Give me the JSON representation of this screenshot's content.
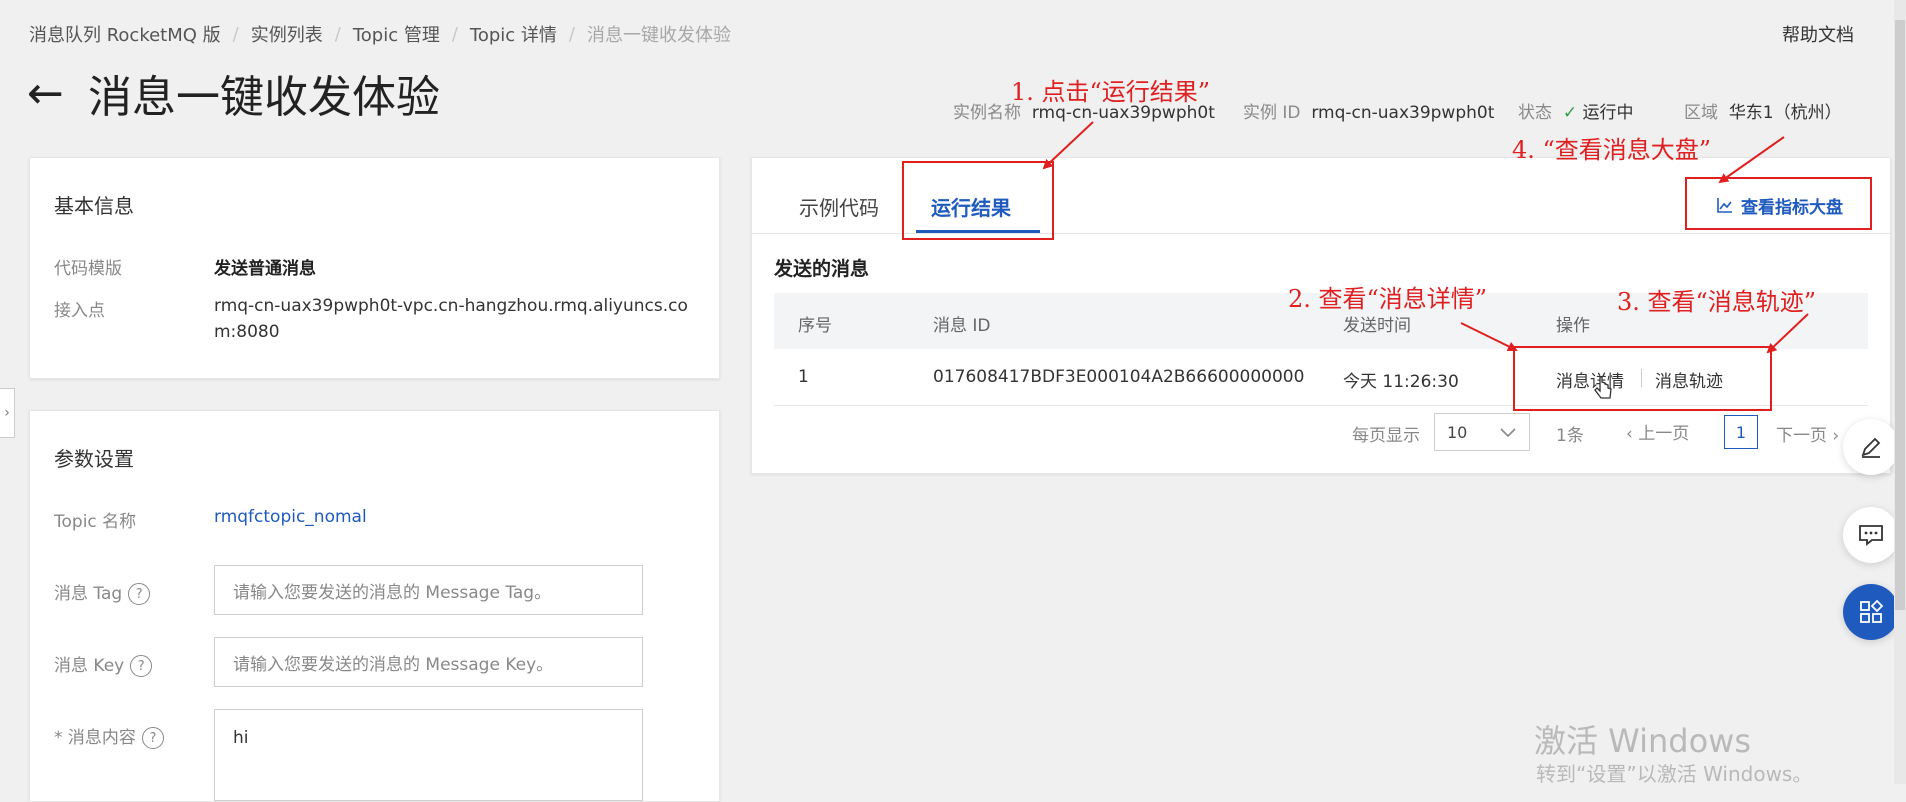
{
  "breadcrumb": [
    "消息队列 RocketMQ 版",
    "实例列表",
    "Topic 管理",
    "Topic 详情",
    "消息一键收发体验"
  ],
  "help_link": "帮助文档",
  "page_title": "消息一键收发体验",
  "instance": {
    "name_label": "实例名称",
    "name_value": "rmq-cn-uax39pwph0t",
    "id_label": "实例 ID",
    "id_value": "rmq-cn-uax39pwph0t",
    "status_label": "状态",
    "status_value": "运行中",
    "region_label": "区域",
    "region_value": "华东1（杭州）"
  },
  "basic_info": {
    "title": "基本信息",
    "template_label": "代码模版",
    "template_value": "发送普通消息",
    "endpoint_label": "接入点",
    "endpoint_line1": "rmq-cn-uax39pwph0t-vpc.cn-hangzhou.rmq.aliyuncs.co",
    "endpoint_line2": "m:8080"
  },
  "params": {
    "title": "参数设置",
    "topic_label": "Topic 名称",
    "topic_value": "rmqfctopic_nomal",
    "tag_label": "消息 Tag",
    "tag_placeholder": "请输入您要发送的消息的 Message Tag。",
    "key_label": "消息 Key",
    "key_placeholder": "请输入您要发送的消息的 Message Key。",
    "content_label": "* 消息内容",
    "content_value": "hi",
    "help_glyph": "?"
  },
  "tabs": {
    "sample_code": "示例代码",
    "run_result": "运行结果"
  },
  "dashboard_button": "查看指标大盘",
  "sent_messages": {
    "title": "发送的消息",
    "columns": [
      "序号",
      "消息 ID",
      "发送时间",
      "操作"
    ],
    "rows": [
      {
        "index": "1",
        "message_id": "017608417BDF3E000104A2B66600000000",
        "time": "今天 11:26:30",
        "detail": "消息详情",
        "trace": "消息轨迹"
      }
    ]
  },
  "pagination": {
    "per_page_label": "每页显示",
    "per_page_value": "10",
    "total": "1条",
    "prev": "上一页",
    "page": "1",
    "next": "下一页"
  },
  "annotations": {
    "step1": "1. 点击“运行结果”",
    "step2": "2. 查看“消息详情”",
    "step3": "3. 查看“消息轨迹”",
    "step4": "4. “查看消息大盘”"
  },
  "watermark": {
    "line1": "激活 Windows",
    "line2": "转到“设置”以激活 Windows。"
  },
  "colors": {
    "accent": "#1f5bbf",
    "annotation": "#e02020",
    "success": "#2ea043"
  }
}
